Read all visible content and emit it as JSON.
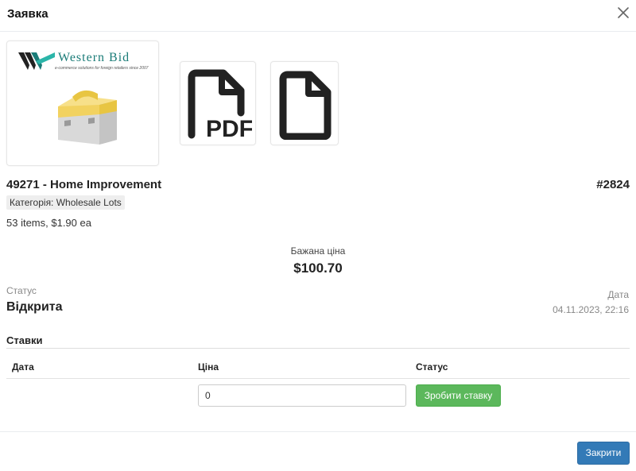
{
  "modal": {
    "title": "Заявка",
    "close_icon": "close-icon"
  },
  "attachments": {
    "main_image": {
      "brand": "Western Bid",
      "tagline": "e-commerce solutions for foreign retailers since 2007",
      "icon": "toolbox-image"
    },
    "pdf_icon": "pdf-file-icon",
    "pdf_label": "PDF",
    "file_icon": "file-icon"
  },
  "lot": {
    "title": "49271 - Home Improvement",
    "number": "#2824",
    "category": "Категорія: Wholesale Lots",
    "items": "53 items, $1.90 ea"
  },
  "desired_price": {
    "label": "Бажана ціна",
    "value": "$100.70"
  },
  "status": {
    "label": "Статус",
    "value": "Відкрита"
  },
  "date": {
    "label": "Дата",
    "value": "04.11.2023, 22:16"
  },
  "bids": {
    "heading": "Ставки",
    "columns": [
      "Дата",
      "Ціна",
      "Статус"
    ],
    "input_value": "0",
    "bid_button": "Зробити ставку"
  },
  "footer": {
    "close_button": "Закрити"
  },
  "colors": {
    "success": "#5cb85c",
    "primary": "#337ab7",
    "brand": "#1b7c78"
  }
}
